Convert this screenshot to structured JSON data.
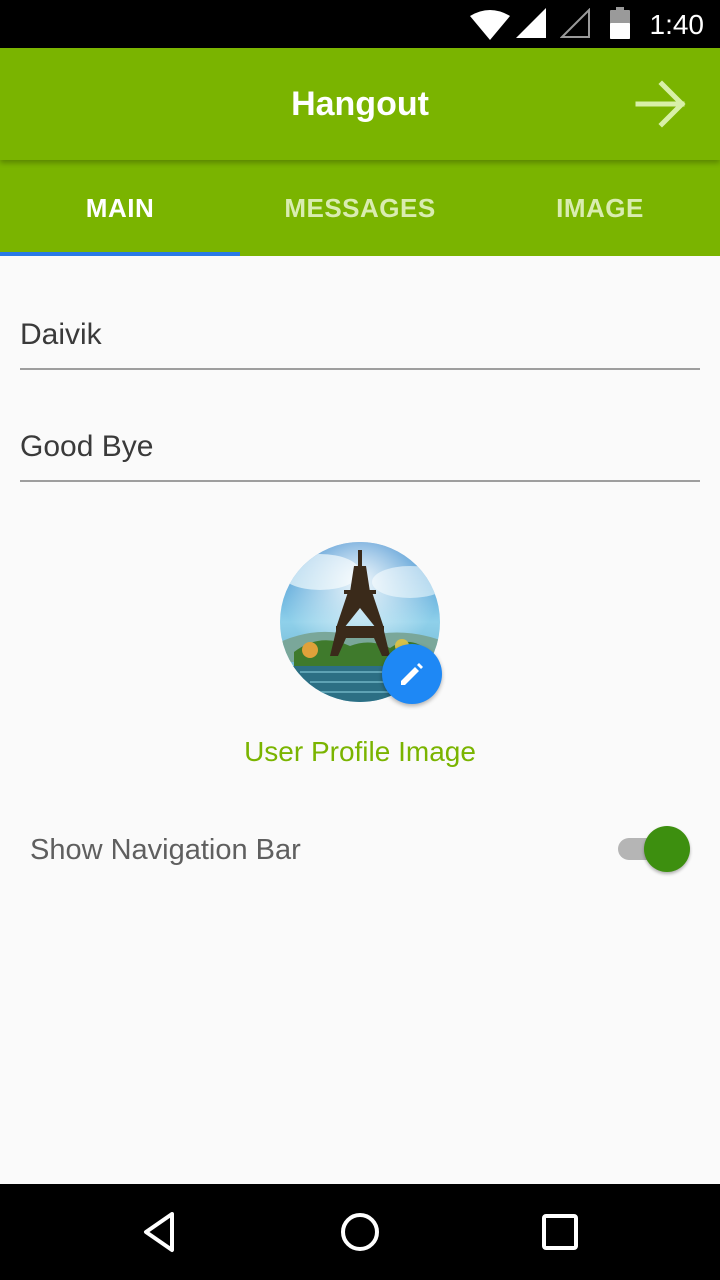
{
  "status_bar": {
    "time": "1:40",
    "icons": [
      "wifi-icon",
      "signal-icon",
      "signal-empty-icon",
      "battery-icon"
    ]
  },
  "app_bar": {
    "title": "Hangout",
    "action_icon": "arrow-forward-icon"
  },
  "tabs": [
    {
      "label": "MAIN",
      "active": true
    },
    {
      "label": "MESSAGES",
      "active": false
    },
    {
      "label": "IMAGE",
      "active": false
    }
  ],
  "form": {
    "name_value": "Daivik",
    "message_value": "Good Bye"
  },
  "profile": {
    "caption": "User Profile Image",
    "edit_icon": "pencil-icon"
  },
  "navigation_toggle": {
    "label": "Show Navigation Bar",
    "on": true
  },
  "system_nav": [
    "back-icon",
    "home-icon",
    "recents-icon"
  ],
  "colors": {
    "primary": "#7ab400",
    "tab_indicator": "#2979e6",
    "fab": "#1e88f5",
    "switch_thumb": "#3d8f0f"
  }
}
